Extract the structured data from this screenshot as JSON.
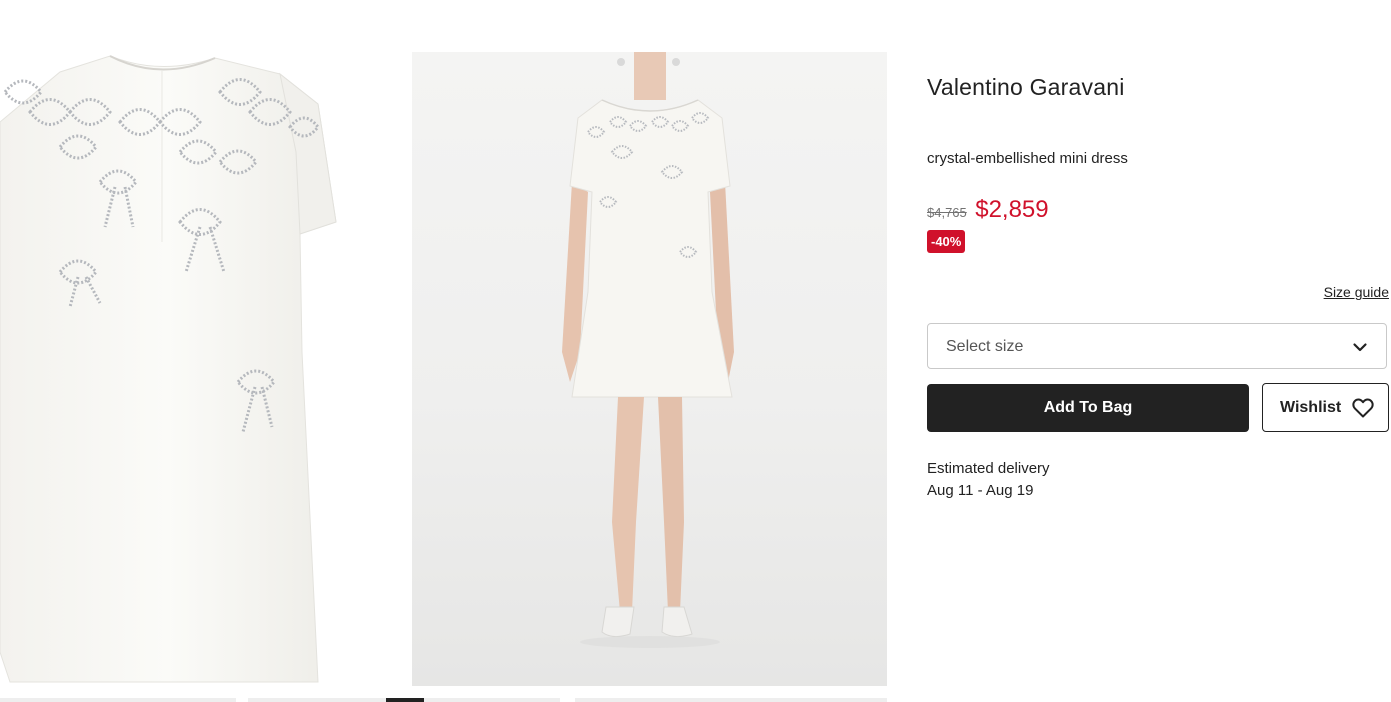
{
  "product": {
    "brand": "Valentino Garavani",
    "name": "crystal-embellished mini dress",
    "price_original": "$4,765",
    "price_sale": "$2,859",
    "discount": "-40%"
  },
  "size": {
    "guide_label": "Size guide",
    "select_placeholder": "Select size"
  },
  "actions": {
    "add_to_bag_label": "Add To Bag",
    "wishlist_label": "Wishlist"
  },
  "delivery": {
    "label": "Estimated delivery",
    "dates": "Aug 11 - Aug 19"
  },
  "gallery": {
    "images": [
      "dress-detail-image",
      "dress-model-image"
    ],
    "active_thumbnail_index": 2
  },
  "colors": {
    "sale_red": "#d0112b",
    "primary_dark": "#222222",
    "dress_ivory": "#f7f6f2",
    "crystal_silver": "#b9bcc0"
  },
  "icons": {
    "size_dropdown": "chevron-down-icon",
    "wishlist": "heart-icon"
  }
}
